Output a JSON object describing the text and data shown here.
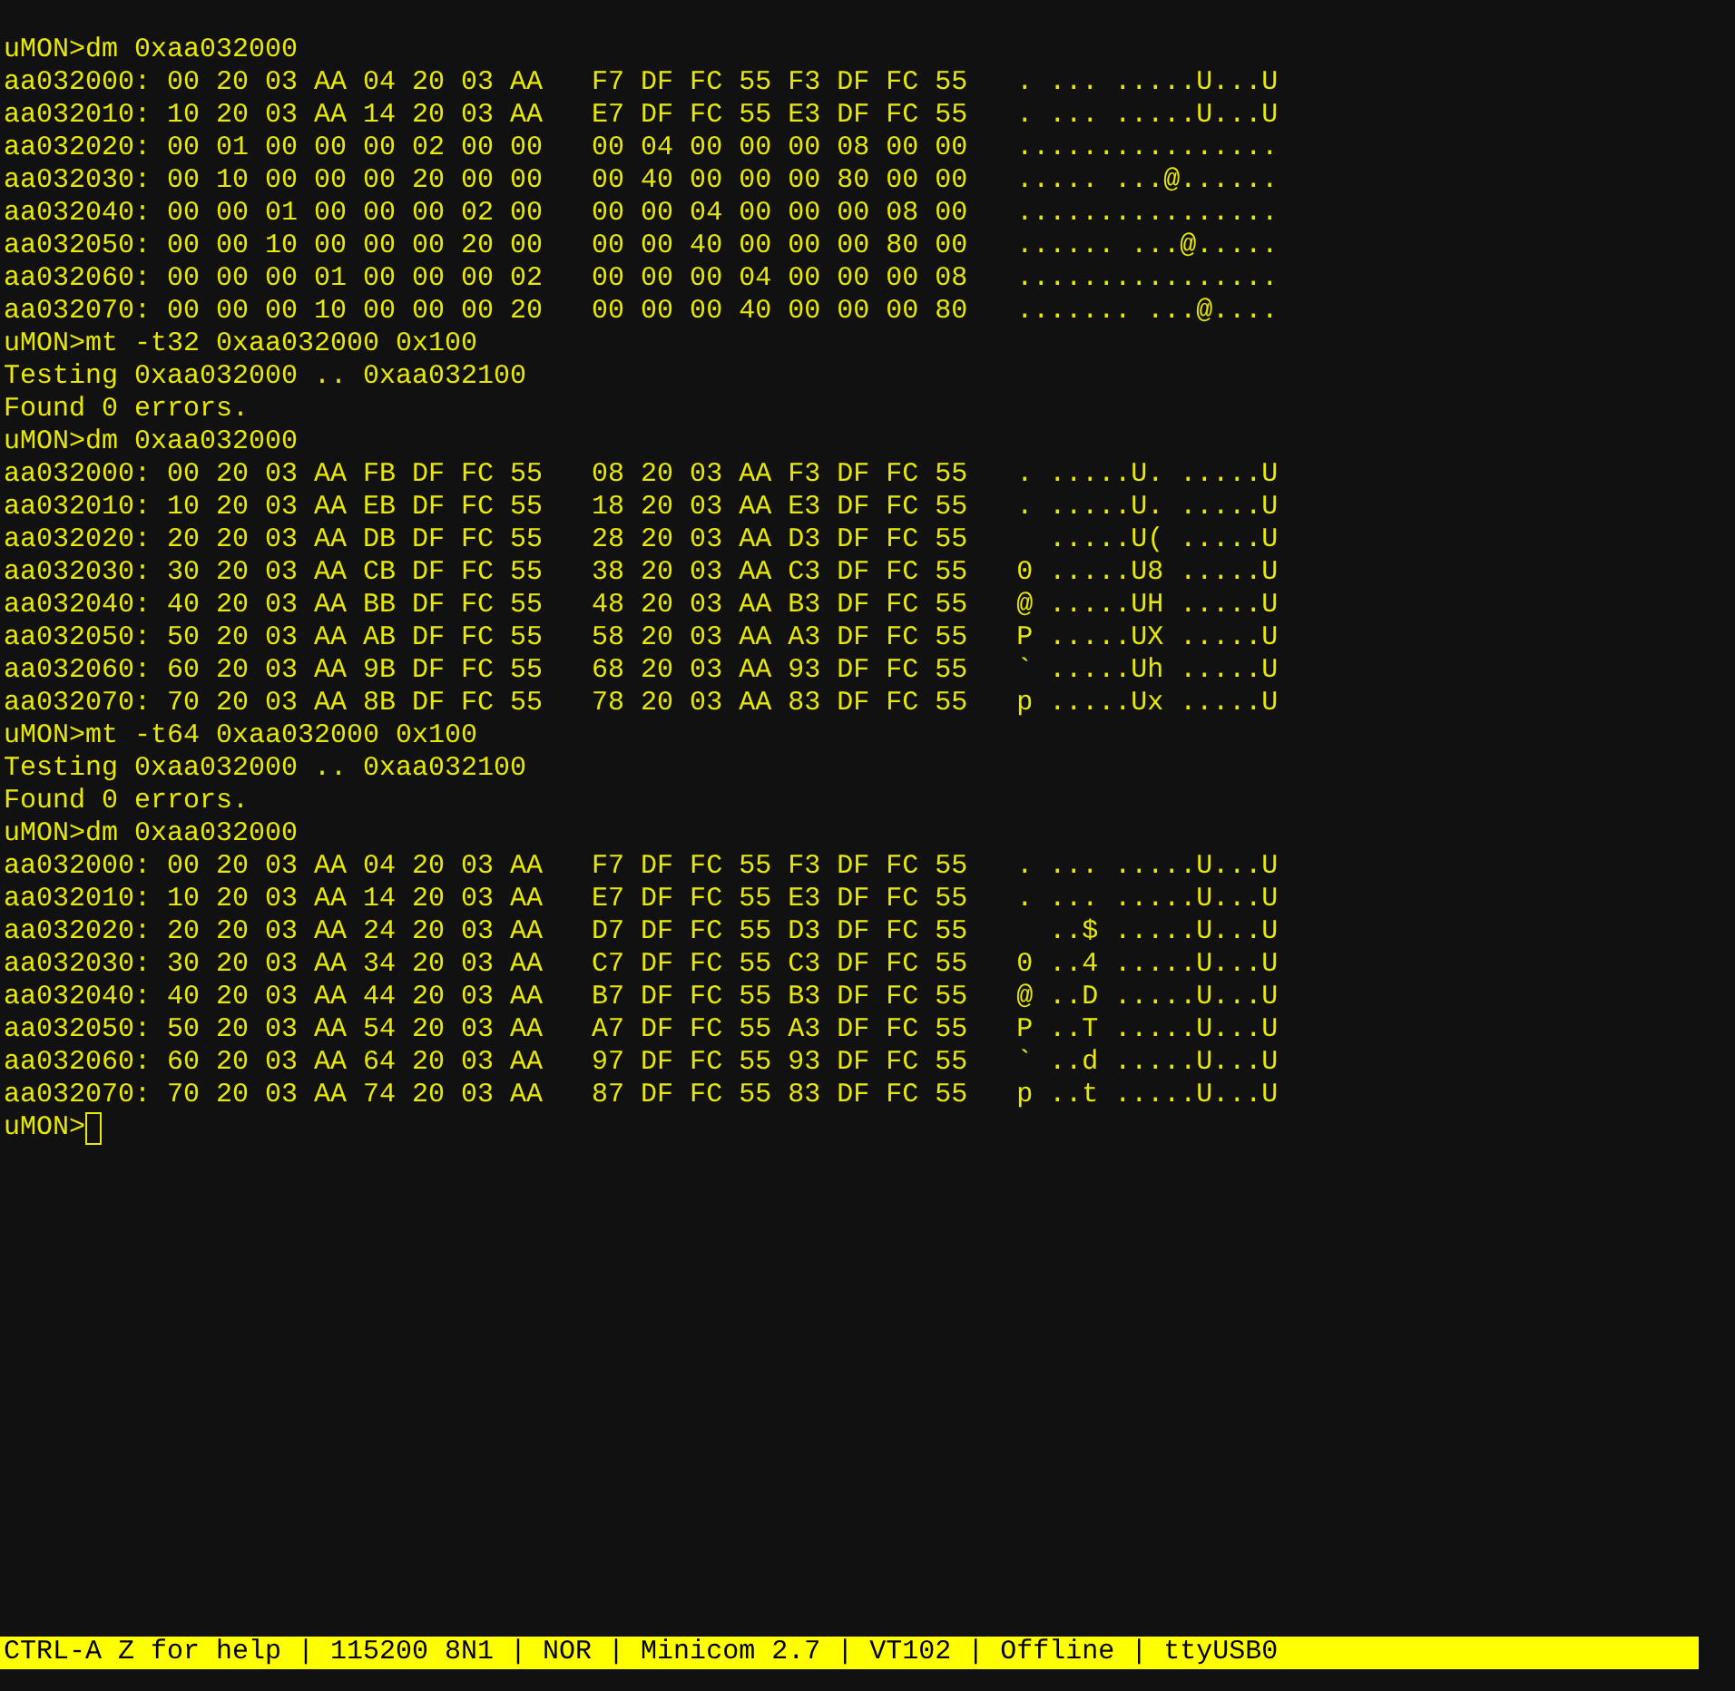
{
  "terminal": {
    "lines": [
      "uMON>dm 0xaa032000",
      "aa032000: 00 20 03 AA 04 20 03 AA   F7 DF FC 55 F3 DF FC 55   . ... .....U...U",
      "aa032010: 10 20 03 AA 14 20 03 AA   E7 DF FC 55 E3 DF FC 55   . ... .....U...U",
      "aa032020: 00 01 00 00 00 02 00 00   00 04 00 00 00 08 00 00   ................",
      "aa032030: 00 10 00 00 00 20 00 00   00 40 00 00 00 80 00 00   ..... ...@......",
      "aa032040: 00 00 01 00 00 00 02 00   00 00 04 00 00 00 08 00   ................",
      "aa032050: 00 00 10 00 00 00 20 00   00 00 40 00 00 00 80 00   ...... ...@.....",
      "aa032060: 00 00 00 01 00 00 00 02   00 00 00 04 00 00 00 08   ................",
      "aa032070: 00 00 00 10 00 00 00 20   00 00 00 40 00 00 00 80   ....... ...@....",
      "uMON>mt -t32 0xaa032000 0x100",
      "Testing 0xaa032000 .. 0xaa032100",
      "Found 0 errors.",
      "uMON>dm 0xaa032000",
      "aa032000: 00 20 03 AA FB DF FC 55   08 20 03 AA F3 DF FC 55   . .....U. .....U",
      "aa032010: 10 20 03 AA EB DF FC 55   18 20 03 AA E3 DF FC 55   . .....U. .....U",
      "aa032020: 20 20 03 AA DB DF FC 55   28 20 03 AA D3 DF FC 55     .....U( .....U",
      "aa032030: 30 20 03 AA CB DF FC 55   38 20 03 AA C3 DF FC 55   0 .....U8 .....U",
      "aa032040: 40 20 03 AA BB DF FC 55   48 20 03 AA B3 DF FC 55   @ .....UH .....U",
      "aa032050: 50 20 03 AA AB DF FC 55   58 20 03 AA A3 DF FC 55   P .....UX .....U",
      "aa032060: 60 20 03 AA 9B DF FC 55   68 20 03 AA 93 DF FC 55   ` .....Uh .....U",
      "aa032070: 70 20 03 AA 8B DF FC 55   78 20 03 AA 83 DF FC 55   p .....Ux .....U",
      "uMON>mt -t64 0xaa032000 0x100",
      "Testing 0xaa032000 .. 0xaa032100",
      "Found 0 errors.",
      "uMON>dm 0xaa032000",
      "aa032000: 00 20 03 AA 04 20 03 AA   F7 DF FC 55 F3 DF FC 55   . ... .....U...U",
      "aa032010: 10 20 03 AA 14 20 03 AA   E7 DF FC 55 E3 DF FC 55   . ... .....U...U",
      "aa032020: 20 20 03 AA 24 20 03 AA   D7 DF FC 55 D3 DF FC 55     ..$ .....U...U",
      "aa032030: 30 20 03 AA 34 20 03 AA   C7 DF FC 55 C3 DF FC 55   0 ..4 .....U...U",
      "aa032040: 40 20 03 AA 44 20 03 AA   B7 DF FC 55 B3 DF FC 55   @ ..D .....U...U",
      "aa032050: 50 20 03 AA 54 20 03 AA   A7 DF FC 55 A3 DF FC 55   P ..T .....U...U",
      "aa032060: 60 20 03 AA 64 20 03 AA   97 DF FC 55 93 DF FC 55   ` ..d .....U...U",
      "aa032070: 70 20 03 AA 74 20 03 AA   87 DF FC 55 83 DF FC 55   p ..t .....U...U"
    ],
    "prompt": "uMON>"
  },
  "status_bar": {
    "text": "CTRL-A Z for help | 115200 8N1 | NOR | Minicom 2.7 | VT102 | Offline | ttyUSB0"
  }
}
